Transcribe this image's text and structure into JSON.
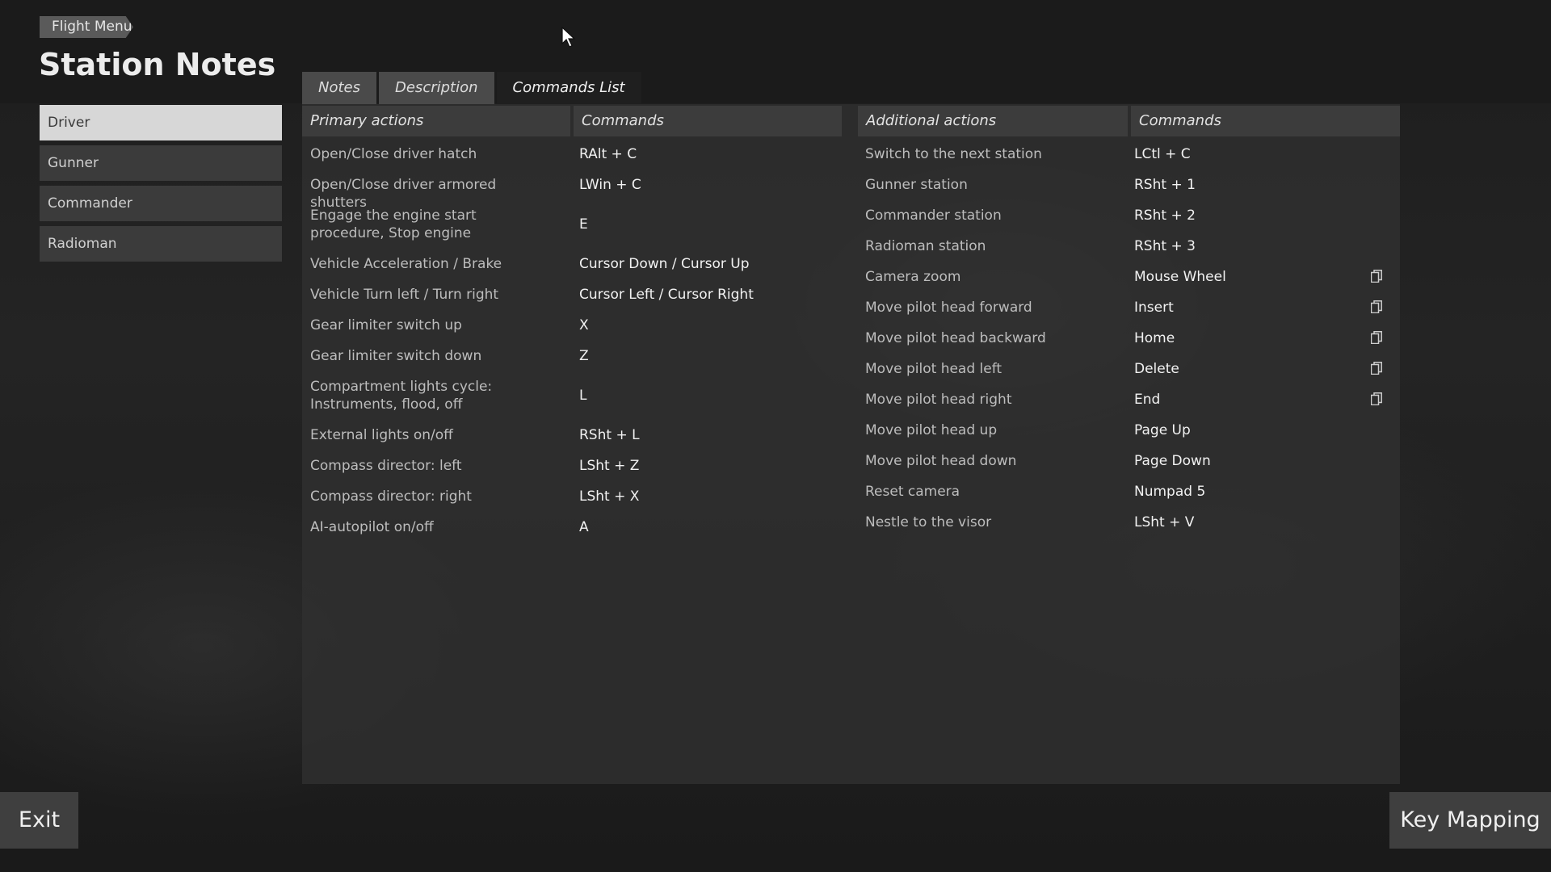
{
  "header": {
    "breadcrumb": "Flight Menu",
    "title": "Station Notes"
  },
  "tabs": [
    {
      "label": "Notes"
    },
    {
      "label": "Description"
    },
    {
      "label": "Commands List",
      "active": true
    }
  ],
  "sidebar": {
    "items": [
      {
        "label": "Driver",
        "active": true
      },
      {
        "label": "Gunner"
      },
      {
        "label": "Commander"
      },
      {
        "label": "Radioman"
      }
    ]
  },
  "table": {
    "left_headers": [
      "Primary actions",
      "Commands"
    ],
    "right_headers": [
      "Additional actions",
      "Commands"
    ],
    "primary": [
      {
        "action": "Open/Close driver hatch",
        "command": "RAlt + C"
      },
      {
        "action": "Open/Close driver armored shutters",
        "command": "LWin + C"
      },
      {
        "action": "Engage the engine start procedure, Stop engine",
        "command": "E"
      },
      {
        "action": "Vehicle Acceleration / Brake",
        "command": "Cursor Down / Cursor Up"
      },
      {
        "action": "Vehicle Turn left / Turn right",
        "command": "Cursor Left / Cursor Right"
      },
      {
        "action": "Gear limiter switch up",
        "command": "X"
      },
      {
        "action": "Gear limiter switch down",
        "command": "Z"
      },
      {
        "action": "Compartment lights cycle: Instruments, flood, off",
        "command": "L"
      },
      {
        "action": "External lights on/off",
        "command": "RSht + L"
      },
      {
        "action": "Compass director: left",
        "command": "LSht + Z"
      },
      {
        "action": "Compass director: right",
        "command": "LSht + X"
      },
      {
        "action": "AI-autopilot on/off",
        "command": "A"
      }
    ],
    "additional": [
      {
        "action": "Switch to the next station",
        "command": "LCtl + C"
      },
      {
        "action": "Gunner station",
        "command": "RSht + 1"
      },
      {
        "action": "Commander station",
        "command": "RSht + 2"
      },
      {
        "action": "Radioman station",
        "command": "RSht + 3"
      },
      {
        "action": "Camera zoom",
        "command": "Mouse Wheel"
      },
      {
        "action": "Move pilot head forward",
        "command": "Insert"
      },
      {
        "action": "Move pilot head backward",
        "command": "Home"
      },
      {
        "action": "Move pilot head left",
        "command": "Delete"
      },
      {
        "action": "Move pilot head right",
        "command": "End"
      },
      {
        "action": "Move pilot head up",
        "command": "Page Up"
      },
      {
        "action": "Move pilot head down",
        "command": "Page Down"
      },
      {
        "action": "Reset camera",
        "command": "Numpad 5"
      },
      {
        "action": "Nestle to the visor",
        "command": "LSht + V"
      }
    ]
  },
  "buttons": {
    "exit": "Exit",
    "key_mapping": "Key Mapping"
  },
  "icons": {
    "copy": "copy-icon",
    "cursor": "mouse-cursor-icon"
  }
}
